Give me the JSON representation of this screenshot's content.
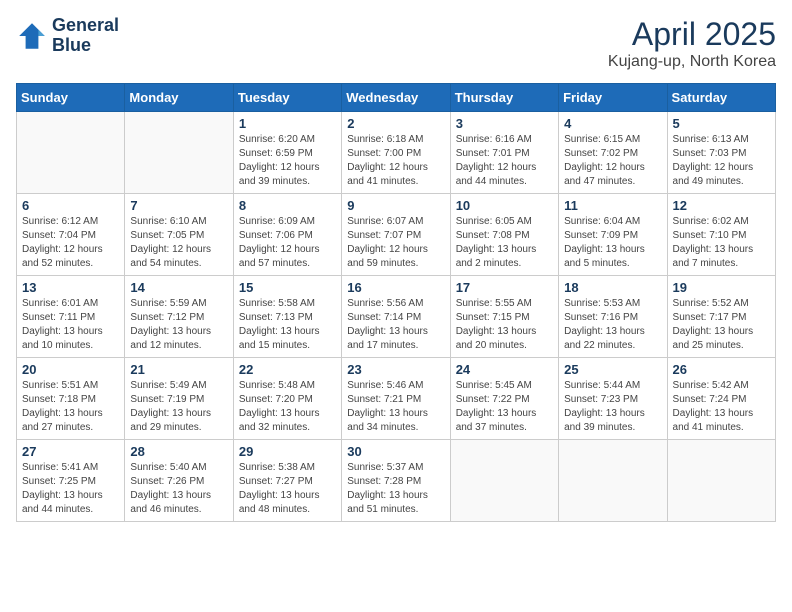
{
  "header": {
    "logo_line1": "General",
    "logo_line2": "Blue",
    "month_title": "April 2025",
    "location": "Kujang-up, North Korea"
  },
  "weekdays": [
    "Sunday",
    "Monday",
    "Tuesday",
    "Wednesday",
    "Thursday",
    "Friday",
    "Saturday"
  ],
  "weeks": [
    [
      {
        "day": "",
        "info": ""
      },
      {
        "day": "",
        "info": ""
      },
      {
        "day": "1",
        "info": "Sunrise: 6:20 AM\nSunset: 6:59 PM\nDaylight: 12 hours and 39 minutes."
      },
      {
        "day": "2",
        "info": "Sunrise: 6:18 AM\nSunset: 7:00 PM\nDaylight: 12 hours and 41 minutes."
      },
      {
        "day": "3",
        "info": "Sunrise: 6:16 AM\nSunset: 7:01 PM\nDaylight: 12 hours and 44 minutes."
      },
      {
        "day": "4",
        "info": "Sunrise: 6:15 AM\nSunset: 7:02 PM\nDaylight: 12 hours and 47 minutes."
      },
      {
        "day": "5",
        "info": "Sunrise: 6:13 AM\nSunset: 7:03 PM\nDaylight: 12 hours and 49 minutes."
      }
    ],
    [
      {
        "day": "6",
        "info": "Sunrise: 6:12 AM\nSunset: 7:04 PM\nDaylight: 12 hours and 52 minutes."
      },
      {
        "day": "7",
        "info": "Sunrise: 6:10 AM\nSunset: 7:05 PM\nDaylight: 12 hours and 54 minutes."
      },
      {
        "day": "8",
        "info": "Sunrise: 6:09 AM\nSunset: 7:06 PM\nDaylight: 12 hours and 57 minutes."
      },
      {
        "day": "9",
        "info": "Sunrise: 6:07 AM\nSunset: 7:07 PM\nDaylight: 12 hours and 59 minutes."
      },
      {
        "day": "10",
        "info": "Sunrise: 6:05 AM\nSunset: 7:08 PM\nDaylight: 13 hours and 2 minutes."
      },
      {
        "day": "11",
        "info": "Sunrise: 6:04 AM\nSunset: 7:09 PM\nDaylight: 13 hours and 5 minutes."
      },
      {
        "day": "12",
        "info": "Sunrise: 6:02 AM\nSunset: 7:10 PM\nDaylight: 13 hours and 7 minutes."
      }
    ],
    [
      {
        "day": "13",
        "info": "Sunrise: 6:01 AM\nSunset: 7:11 PM\nDaylight: 13 hours and 10 minutes."
      },
      {
        "day": "14",
        "info": "Sunrise: 5:59 AM\nSunset: 7:12 PM\nDaylight: 13 hours and 12 minutes."
      },
      {
        "day": "15",
        "info": "Sunrise: 5:58 AM\nSunset: 7:13 PM\nDaylight: 13 hours and 15 minutes."
      },
      {
        "day": "16",
        "info": "Sunrise: 5:56 AM\nSunset: 7:14 PM\nDaylight: 13 hours and 17 minutes."
      },
      {
        "day": "17",
        "info": "Sunrise: 5:55 AM\nSunset: 7:15 PM\nDaylight: 13 hours and 20 minutes."
      },
      {
        "day": "18",
        "info": "Sunrise: 5:53 AM\nSunset: 7:16 PM\nDaylight: 13 hours and 22 minutes."
      },
      {
        "day": "19",
        "info": "Sunrise: 5:52 AM\nSunset: 7:17 PM\nDaylight: 13 hours and 25 minutes."
      }
    ],
    [
      {
        "day": "20",
        "info": "Sunrise: 5:51 AM\nSunset: 7:18 PM\nDaylight: 13 hours and 27 minutes."
      },
      {
        "day": "21",
        "info": "Sunrise: 5:49 AM\nSunset: 7:19 PM\nDaylight: 13 hours and 29 minutes."
      },
      {
        "day": "22",
        "info": "Sunrise: 5:48 AM\nSunset: 7:20 PM\nDaylight: 13 hours and 32 minutes."
      },
      {
        "day": "23",
        "info": "Sunrise: 5:46 AM\nSunset: 7:21 PM\nDaylight: 13 hours and 34 minutes."
      },
      {
        "day": "24",
        "info": "Sunrise: 5:45 AM\nSunset: 7:22 PM\nDaylight: 13 hours and 37 minutes."
      },
      {
        "day": "25",
        "info": "Sunrise: 5:44 AM\nSunset: 7:23 PM\nDaylight: 13 hours and 39 minutes."
      },
      {
        "day": "26",
        "info": "Sunrise: 5:42 AM\nSunset: 7:24 PM\nDaylight: 13 hours and 41 minutes."
      }
    ],
    [
      {
        "day": "27",
        "info": "Sunrise: 5:41 AM\nSunset: 7:25 PM\nDaylight: 13 hours and 44 minutes."
      },
      {
        "day": "28",
        "info": "Sunrise: 5:40 AM\nSunset: 7:26 PM\nDaylight: 13 hours and 46 minutes."
      },
      {
        "day": "29",
        "info": "Sunrise: 5:38 AM\nSunset: 7:27 PM\nDaylight: 13 hours and 48 minutes."
      },
      {
        "day": "30",
        "info": "Sunrise: 5:37 AM\nSunset: 7:28 PM\nDaylight: 13 hours and 51 minutes."
      },
      {
        "day": "",
        "info": ""
      },
      {
        "day": "",
        "info": ""
      },
      {
        "day": "",
        "info": ""
      }
    ]
  ]
}
